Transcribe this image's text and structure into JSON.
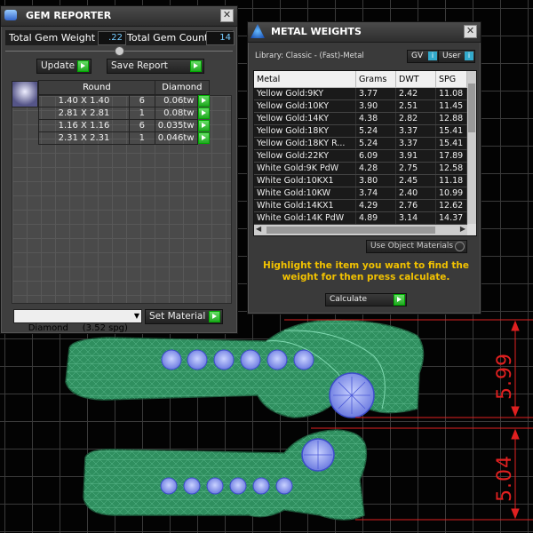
{
  "gem_reporter": {
    "title": "GEM REPORTER",
    "total_weight_label": "Total Gem Weight",
    "total_weight_value": ".22",
    "total_count_label": "Total Gem Count",
    "total_count_value": "14",
    "update_label": "Update",
    "save_report_label": "Save Report",
    "table_headers": [
      "Round",
      "Diamond"
    ],
    "rows": [
      {
        "size": "1.40 X 1.40",
        "count": "6",
        "weight": "0.06tw"
      },
      {
        "size": "2.81 X 2.81",
        "count": "1",
        "weight": "0.08tw"
      },
      {
        "size": "1.16 X 1.16",
        "count": "6",
        "weight": "0.035tw"
      },
      {
        "size": "2.31 X 2.31",
        "count": "1",
        "weight": "0.046tw"
      }
    ],
    "material_select": "Diamond     (3.52 spg)",
    "set_material_label": "Set Material"
  },
  "metal_weights": {
    "title": "METAL WEIGHTS",
    "library_label": "Library: Classic - (Fast)-Metal",
    "gv_label": "GV",
    "user_label": "User",
    "columns": [
      "Metal",
      "Grams",
      "DWT",
      "SPG"
    ],
    "rows": [
      {
        "metal": "Yellow Gold:9KY",
        "grams": "3.77",
        "dwt": "2.42",
        "spg": "11.08"
      },
      {
        "metal": "Yellow Gold:10KY",
        "grams": "3.90",
        "dwt": "2.51",
        "spg": "11.45"
      },
      {
        "metal": "Yellow Gold:14KY",
        "grams": "4.38",
        "dwt": "2.82",
        "spg": "12.88"
      },
      {
        "metal": "Yellow Gold:18KY",
        "grams": "5.24",
        "dwt": "3.37",
        "spg": "15.41"
      },
      {
        "metal": "Yellow Gold:18KY R...",
        "grams": "5.24",
        "dwt": "3.37",
        "spg": "15.41"
      },
      {
        "metal": "Yellow Gold:22KY",
        "grams": "6.09",
        "dwt": "3.91",
        "spg": "17.89"
      },
      {
        "metal": "White Gold:9K PdW",
        "grams": "4.28",
        "dwt": "2.75",
        "spg": "12.58"
      },
      {
        "metal": "White Gold:10KX1",
        "grams": "3.80",
        "dwt": "2.45",
        "spg": "11.18"
      },
      {
        "metal": "White Gold:10KW",
        "grams": "3.74",
        "dwt": "2.40",
        "spg": "10.99"
      },
      {
        "metal": "White Gold:14KX1",
        "grams": "4.29",
        "dwt": "2.76",
        "spg": "12.62"
      },
      {
        "metal": "White Gold:14K PdW",
        "grams": "4.89",
        "dwt": "3.14",
        "spg": "14.37"
      }
    ],
    "use_object_materials": "Use Object Materials",
    "instruction": "Highlight the item you want to find the weight for then press calculate.",
    "calculate_label": "Calculate"
  },
  "dimensions": {
    "top": "5.99",
    "bottom": "5.04"
  },
  "colors": {
    "dim_red": "#e02020",
    "ring_green": "#2f8f5f",
    "gem_blue": "#8a9cff",
    "instruction_yellow": "#f2c200"
  }
}
